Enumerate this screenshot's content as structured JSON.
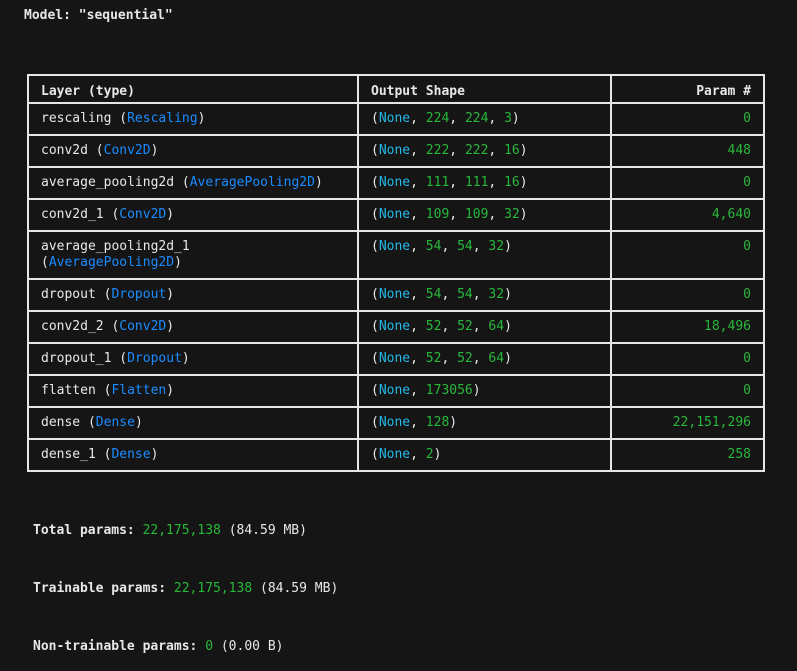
{
  "model": {
    "title": "Model: \"sequential\""
  },
  "table": {
    "headers": [
      "Layer (type)",
      "Output Shape",
      "Param #"
    ],
    "rows": [
      {
        "name": "rescaling",
        "type": "Rescaling",
        "shape": [
          "None",
          "224",
          "224",
          "3"
        ],
        "params": "0"
      },
      {
        "name": "conv2d",
        "type": "Conv2D",
        "shape": [
          "None",
          "222",
          "222",
          "16"
        ],
        "params": "448"
      },
      {
        "name": "average_pooling2d",
        "type": "AveragePooling2D",
        "shape": [
          "None",
          "111",
          "111",
          "16"
        ],
        "params": "0"
      },
      {
        "name": "conv2d_1",
        "type": "Conv2D",
        "shape": [
          "None",
          "109",
          "109",
          "32"
        ],
        "params": "4,640"
      },
      {
        "name": "average_pooling2d_1",
        "type": "AveragePooling2D",
        "shape": [
          "None",
          "54",
          "54",
          "32"
        ],
        "params": "0",
        "wrap": true
      },
      {
        "name": "dropout",
        "type": "Dropout",
        "shape": [
          "None",
          "54",
          "54",
          "32"
        ],
        "params": "0"
      },
      {
        "name": "conv2d_2",
        "type": "Conv2D",
        "shape": [
          "None",
          "52",
          "52",
          "64"
        ],
        "params": "18,496"
      },
      {
        "name": "dropout_1",
        "type": "Dropout",
        "shape": [
          "None",
          "52",
          "52",
          "64"
        ],
        "params": "0"
      },
      {
        "name": "flatten",
        "type": "Flatten",
        "shape": [
          "None",
          "173056"
        ],
        "params": "0"
      },
      {
        "name": "dense",
        "type": "Dense",
        "shape": [
          "None",
          "128"
        ],
        "params": "22,151,296"
      },
      {
        "name": "dense_1",
        "type": "Dense",
        "shape": [
          "None",
          "2"
        ],
        "params": "258"
      }
    ]
  },
  "totals": {
    "total": {
      "label": "Total params:",
      "count": "22,175,138",
      "size": "(84.59 MB)"
    },
    "trainable": {
      "label": "Trainable params:",
      "count": "22,175,138",
      "size": "(84.59 MB)"
    },
    "non_trainable": {
      "label": "Non-trainable params:",
      "count": "0",
      "size": "(0.00 B)"
    }
  },
  "colors": {
    "background": "#151515",
    "layer_type": "#1a8cff",
    "shape_none": "#22b8e8",
    "number": "#27b83a"
  }
}
